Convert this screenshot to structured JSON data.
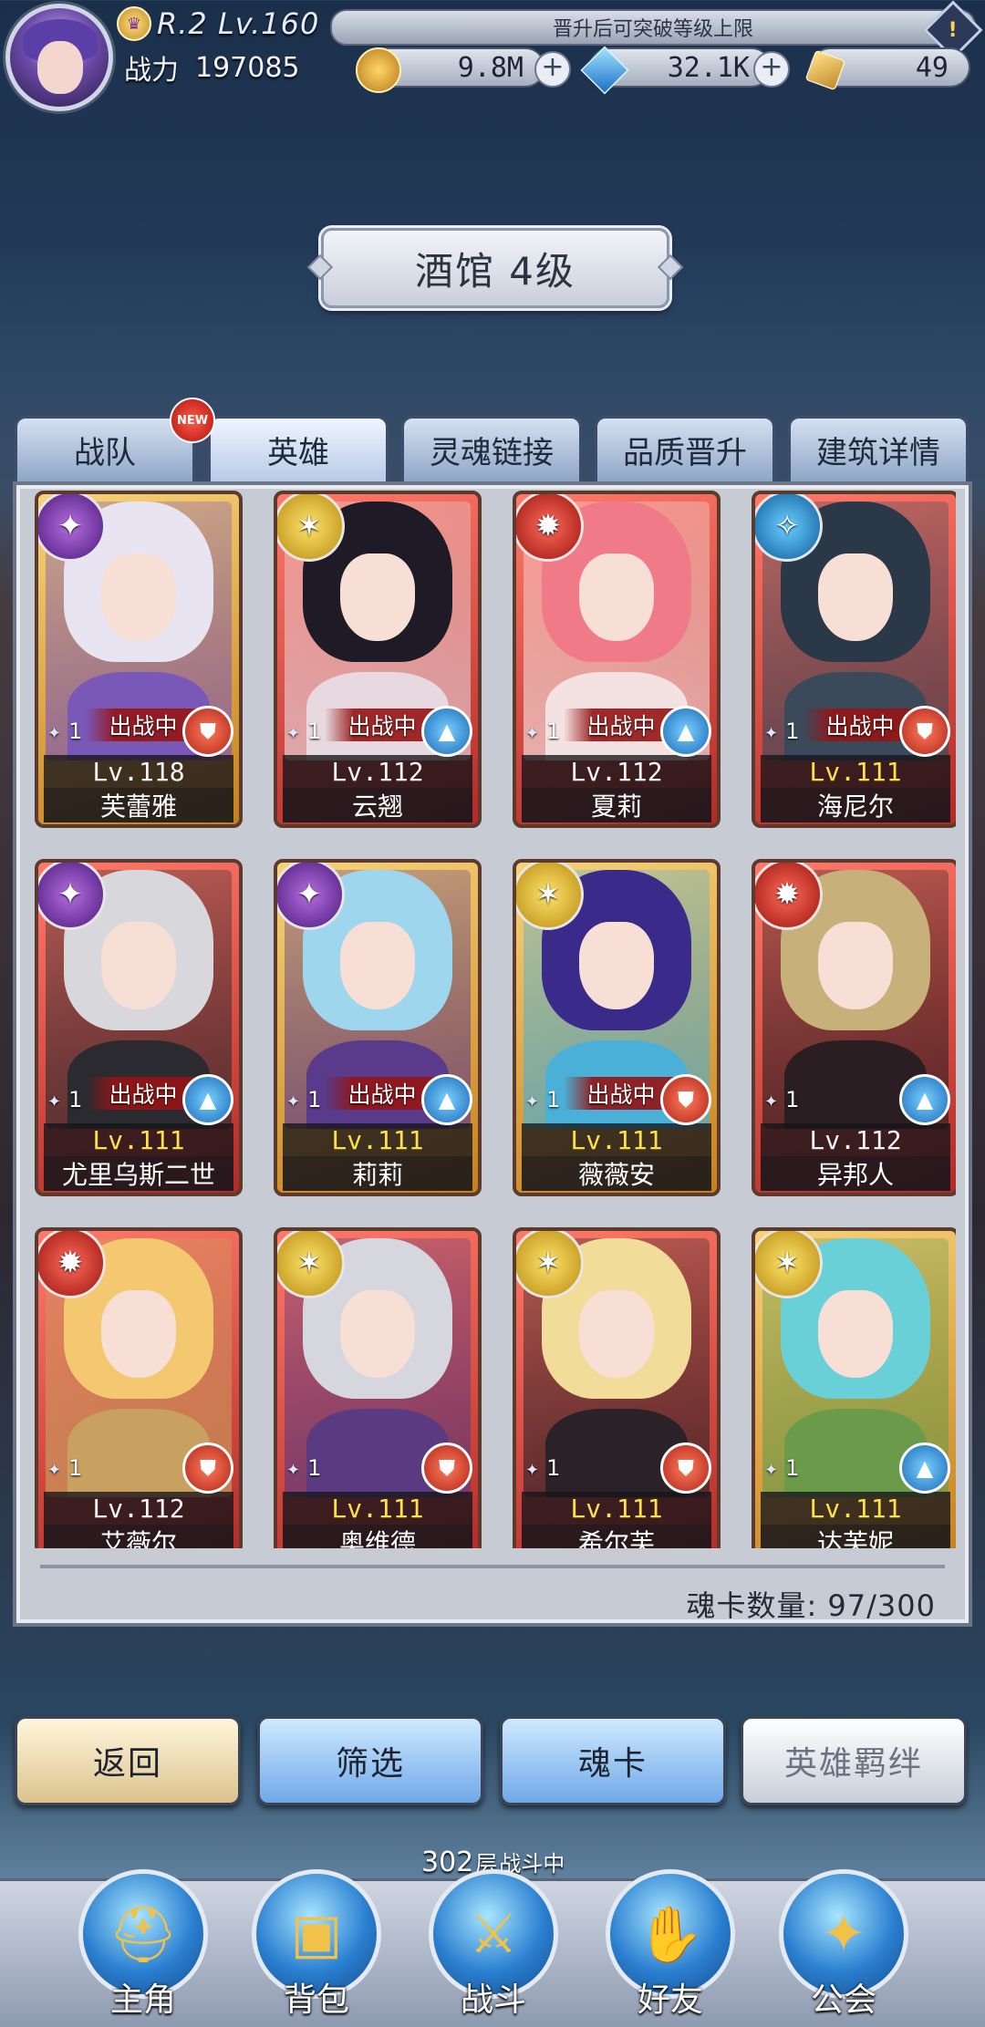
{
  "header": {
    "rank": "R.2 Lv.160",
    "notice": "晋升后可突破等级上限",
    "power_label": "战力",
    "power_value": "197085",
    "gold": "9.8M",
    "gems": "32.1K",
    "tickets": "49"
  },
  "title": "酒馆 4级",
  "tabs": [
    {
      "label": "战队",
      "badge": "NEW"
    },
    {
      "label": "英雄"
    },
    {
      "label": "灵魂链接"
    },
    {
      "label": "品质晋升"
    },
    {
      "label": "建筑详情"
    }
  ],
  "deploy_label": "出战中",
  "heroes": [
    {
      "name": "芙蕾雅",
      "level": "Lv.118",
      "stars": "1",
      "class": "warrior",
      "element": "purple",
      "deployed": true,
      "frame": "gold",
      "hair": "#e8e4f2",
      "outfit": "#7a58b8"
    },
    {
      "name": "云翘",
      "level": "Lv.112",
      "stars": "1",
      "class": "mage",
      "element": "yellow",
      "deployed": true,
      "frame": "red",
      "hair": "#1e1a26",
      "outfit": "#e8d8e0"
    },
    {
      "name": "夏莉",
      "level": "Lv.112",
      "stars": "1",
      "class": "mage",
      "element": "red",
      "deployed": true,
      "frame": "red",
      "hair": "#f07a88",
      "outfit": "#f4e2e2"
    },
    {
      "name": "海尼尔",
      "level": "Lv.111",
      "stars": "1",
      "class": "warrior",
      "element": "blue",
      "deployed": true,
      "frame": "red",
      "hair": "#2a3848",
      "outfit": "#3a4a5a"
    },
    {
      "name": "尤里乌斯二世",
      "level": "Lv.111",
      "stars": "1",
      "class": "mage",
      "element": "purple",
      "deployed": true,
      "frame": "red",
      "hair": "#d8d8dc",
      "outfit": "#2a2a30"
    },
    {
      "name": "莉莉",
      "level": "Lv.111",
      "stars": "1",
      "class": "mage",
      "element": "purple",
      "deployed": true,
      "frame": "gold",
      "hair": "#9ed6ee",
      "outfit": "#5a3a8a"
    },
    {
      "name": "薇薇安",
      "level": "Lv.111",
      "stars": "1",
      "class": "warrior",
      "element": "yellow",
      "deployed": true,
      "frame": "gold",
      "hair": "#3a2a8a",
      "outfit": "#4ab0d8"
    },
    {
      "name": "异邦人",
      "level": "Lv.112",
      "stars": "1",
      "class": "mage",
      "element": "red",
      "deployed": false,
      "frame": "red",
      "hair": "#c8b07a",
      "outfit": "#2a1e22"
    },
    {
      "name": "艾薇尔",
      "level": "Lv.112",
      "stars": "1",
      "class": "warrior",
      "element": "red",
      "deployed": false,
      "frame": "red",
      "hair": "#f4c870",
      "outfit": "#c8a060"
    },
    {
      "name": "奥维德",
      "level": "Lv.111",
      "stars": "1",
      "class": "warrior",
      "element": "yellow",
      "deployed": false,
      "frame": "red",
      "hair": "#d6d6de",
      "outfit": "#5a3a80"
    },
    {
      "name": "希尔芙",
      "level": "Lv.111",
      "stars": "1",
      "class": "warrior",
      "element": "yellow",
      "deployed": false,
      "frame": "red",
      "hair": "#f2dc9a",
      "outfit": "#2a2228"
    },
    {
      "name": "达芙妮",
      "level": "Lv.111",
      "stars": "1",
      "class": "mage",
      "element": "yellow",
      "deployed": false,
      "frame": "gold",
      "hair": "#6ad0d8",
      "outfit": "#6a9a4a"
    }
  ],
  "highlight_levels": [
    "Lv.111"
  ],
  "card_count": "魂卡数量: 97/300",
  "buttons": {
    "back": "返回",
    "filter": "筛选",
    "soul_card": "魂卡",
    "hero_bond": "英雄羁绊"
  },
  "battle_status": {
    "floor": "302",
    "floor_unit": "层",
    "text": "战斗中"
  },
  "nav": [
    {
      "label": "主角",
      "icon": "helmet-icon"
    },
    {
      "label": "背包",
      "icon": "backpack-icon"
    },
    {
      "label": "战斗",
      "icon": "crossed-swords-icon"
    },
    {
      "label": "好友",
      "icon": "handshake-icon"
    },
    {
      "label": "公会",
      "icon": "guild-crest-icon"
    }
  ]
}
